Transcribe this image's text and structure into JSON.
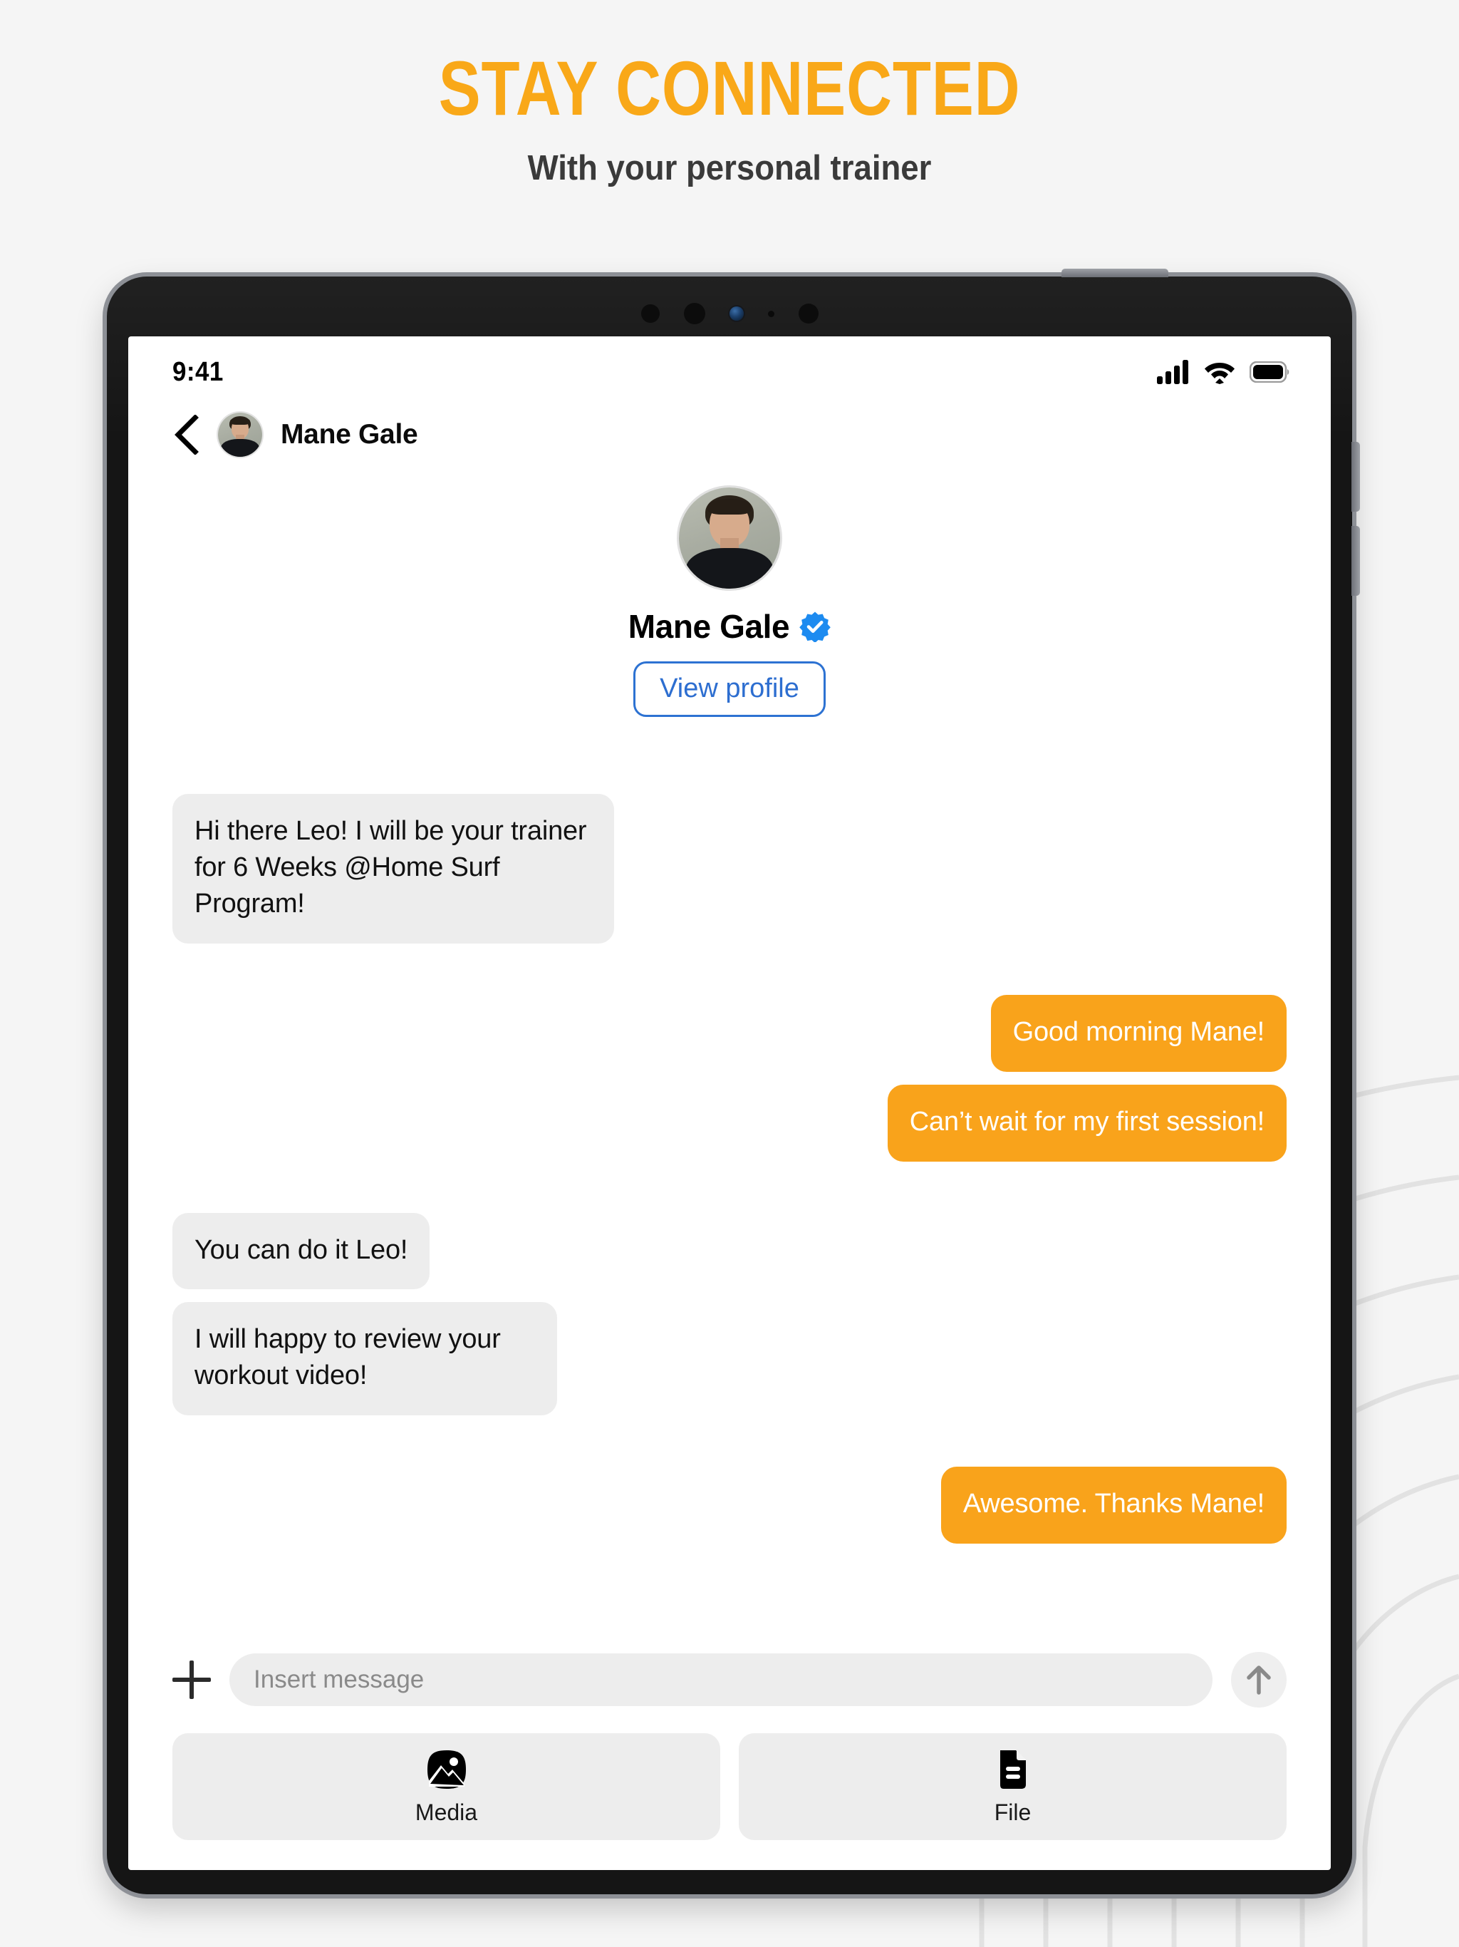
{
  "promo": {
    "headline": "STAY CONNECTED",
    "subhead": "With your personal trainer",
    "headline_color": "#f9a818",
    "subhead_color": "#3a3a3a",
    "background_color": "#f5f5f5"
  },
  "status_bar": {
    "time": "9:41",
    "icons": [
      "cellular-signal-icon",
      "wifi-icon",
      "battery-icon"
    ]
  },
  "navbar": {
    "back_icon": "chevron-left-icon",
    "contact_name": "Mane Gale",
    "avatar": "contact-avatar"
  },
  "profile": {
    "name": "Mane Gale",
    "verified": true,
    "verified_icon": "verified-badge-icon",
    "view_profile_label": "View profile",
    "accent_color": "#2d72d2"
  },
  "chat": {
    "incoming_bubble_color": "#ededed",
    "outgoing_bubble_color": "#f9a31b",
    "outgoing_text_color": "#ffffff",
    "messages": [
      {
        "id": 0,
        "direction": "in",
        "text": "Hi there Leo! I will be your trainer for 6 Weeks @Home Surf Program!"
      },
      {
        "id": 1,
        "direction": "out",
        "text": "Good morning Mane!"
      },
      {
        "id": 2,
        "direction": "out",
        "text": "Can’t wait for my first session!"
      },
      {
        "id": 3,
        "direction": "in",
        "text": "You can do it Leo!"
      },
      {
        "id": 4,
        "direction": "in",
        "text": "I will happy to review your workout video!"
      },
      {
        "id": 5,
        "direction": "out",
        "text": "Awesome. Thanks Mane!"
      }
    ]
  },
  "composer": {
    "add_icon": "plus-icon",
    "input_value": "",
    "input_placeholder": "Insert message",
    "send_icon": "arrow-up-icon"
  },
  "attachments": [
    {
      "id": "media",
      "label": "Media",
      "icon": "image-icon"
    },
    {
      "id": "file",
      "label": "File",
      "icon": "document-icon"
    }
  ],
  "device": {
    "frame_color": "#151515",
    "edge_color": "#8d9096",
    "buttons": [
      "power-button",
      "volume-up-button",
      "volume-down-button"
    ]
  }
}
